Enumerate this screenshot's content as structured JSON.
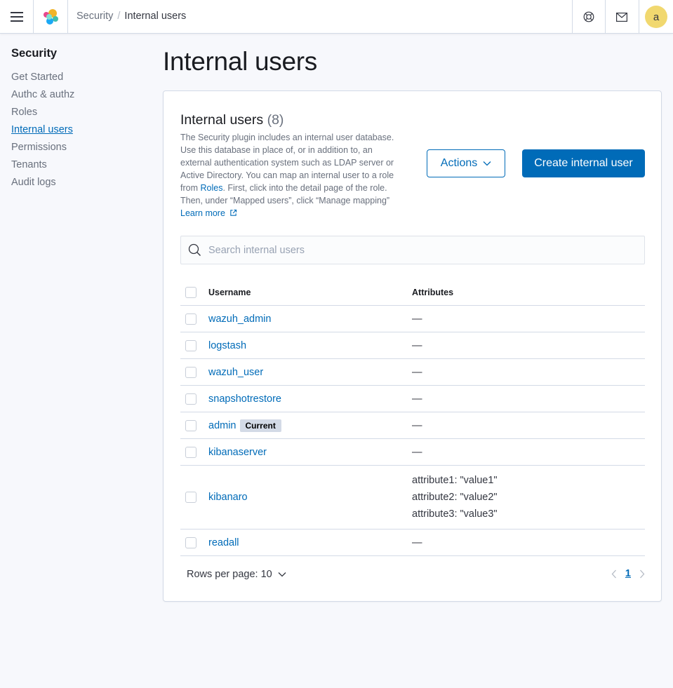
{
  "header": {
    "breadcrumbs": [
      "Security",
      "Internal users"
    ],
    "avatar_initial": "a"
  },
  "sidenav": {
    "title": "Security",
    "items": [
      {
        "label": "Get Started",
        "active": false
      },
      {
        "label": "Authc & authz",
        "active": false
      },
      {
        "label": "Roles",
        "active": false
      },
      {
        "label": "Internal users",
        "active": true
      },
      {
        "label": "Permissions",
        "active": false
      },
      {
        "label": "Tenants",
        "active": false
      },
      {
        "label": "Audit logs",
        "active": false
      }
    ]
  },
  "page": {
    "title": "Internal users"
  },
  "panel": {
    "heading": "Internal users",
    "count": "(8)",
    "desc_before_roles": "The Security plugin includes an internal user database. Use this database in place of, or in addition to, an external authentication system such as LDAP server or Active Directory. You can map an internal user to a role from ",
    "roles_link": "Roles",
    "desc_after_roles": ". First, click into the detail page of the role. Then, under “Mapped users”, click “Manage mapping”",
    "learn_more": "Learn more",
    "actions_label": "Actions",
    "create_label": "Create internal user"
  },
  "search": {
    "placeholder": "Search internal users",
    "value": ""
  },
  "table": {
    "columns": [
      "Username",
      "Attributes"
    ],
    "rows": [
      {
        "username": "wazuh_admin",
        "badge": "",
        "attributes": [
          "—"
        ]
      },
      {
        "username": "logstash",
        "badge": "",
        "attributes": [
          "—"
        ]
      },
      {
        "username": "wazuh_user",
        "badge": "",
        "attributes": [
          "—"
        ]
      },
      {
        "username": "snapshotrestore",
        "badge": "",
        "attributes": [
          "—"
        ]
      },
      {
        "username": "admin",
        "badge": "Current",
        "attributes": [
          "—"
        ]
      },
      {
        "username": "kibanaserver",
        "badge": "",
        "attributes": [
          "—"
        ]
      },
      {
        "username": "kibanaro",
        "badge": "",
        "attributes": [
          "attribute1: \"value1\"",
          "attribute2: \"value2\"",
          "attribute3: \"value3\""
        ]
      },
      {
        "username": "readall",
        "badge": "",
        "attributes": [
          "—"
        ]
      }
    ]
  },
  "pagination": {
    "rows_per_page": "Rows per page: 10",
    "current_page": "1"
  },
  "colors": {
    "accent": "#006bb8",
    "avatar": "#f1d86f",
    "badge": "#d3dae6"
  }
}
